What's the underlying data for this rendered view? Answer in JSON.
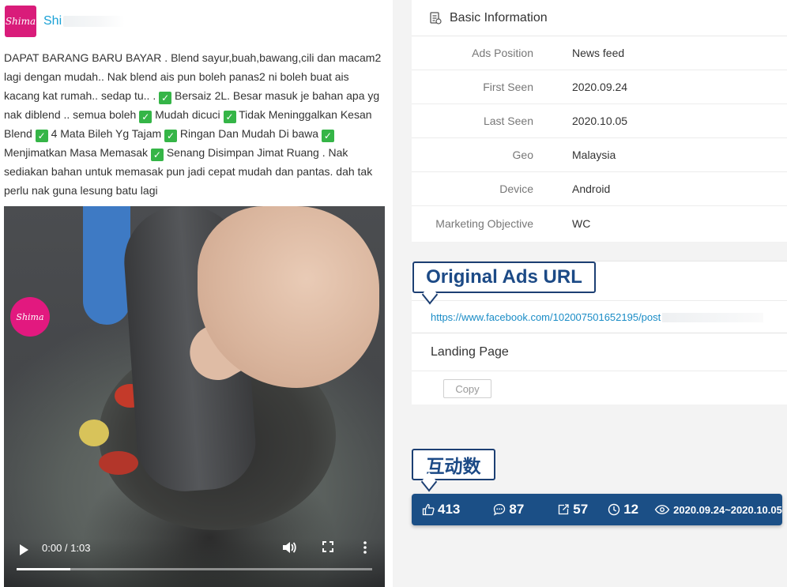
{
  "advertiser": {
    "name": "Shi"
  },
  "logo_text": "Shima",
  "post": {
    "segments": [
      "DAPAT BARANG BARU BAYAR . Blend sayur,buah,bawang,cili dan macam2 lagi dengan mudah.. Nak blend ais pun boleh panas2 ni boleh buat ais kacang kat rumah.. sedap tu.. . ",
      " Bersaiz 2L. Besar masuk je bahan apa yg nak diblend .. semua boleh ",
      " Mudah dicuci ",
      " Tidak Meninggalkan Kesan Blend ",
      " 4 Mata Bileh Yg Tajam ",
      " Ringan Dan Mudah Di bawa ",
      " Menjimatkan Masa Memasak ",
      " Senang Disimpan Jimat Ruang . Nak sediakan bahan untuk memasak pun jadi cepat mudah dan pantas. dah tak perlu nak guna lesung batu lagi"
    ],
    "check_glyph": "✓"
  },
  "video": {
    "time": "0:00 / 1:03",
    "progress": 0.15,
    "watermark": "Shima"
  },
  "basic_info": {
    "title": "Basic Information",
    "rows": [
      {
        "key": "Ads Position",
        "value": "News feed"
      },
      {
        "key": "First Seen",
        "value": "2020.09.24"
      },
      {
        "key": "Last Seen",
        "value": "2020.10.05"
      },
      {
        "key": "Geo",
        "value": "Malaysia"
      },
      {
        "key": "Device",
        "value": "Android"
      },
      {
        "key": "Marketing Objective",
        "value": "WC"
      }
    ]
  },
  "ads_url": {
    "callout": "Original Ads URL",
    "url": "https://www.facebook.com/102007501652195/post"
  },
  "landing": {
    "title": "Landing Page",
    "copy_label": "Copy"
  },
  "stats": {
    "callout": "互动数",
    "likes": "413",
    "comments": "87",
    "shares": "57",
    "views_clock": "12",
    "date_range": "2020.09.24~2020.10.05"
  },
  "colors": {
    "accent": "#1aa1d6",
    "stats_bar": "#1b4f86",
    "callout_border": "#1c3f73",
    "brand_pink": "#d91c7a",
    "check_green": "#35b547"
  }
}
